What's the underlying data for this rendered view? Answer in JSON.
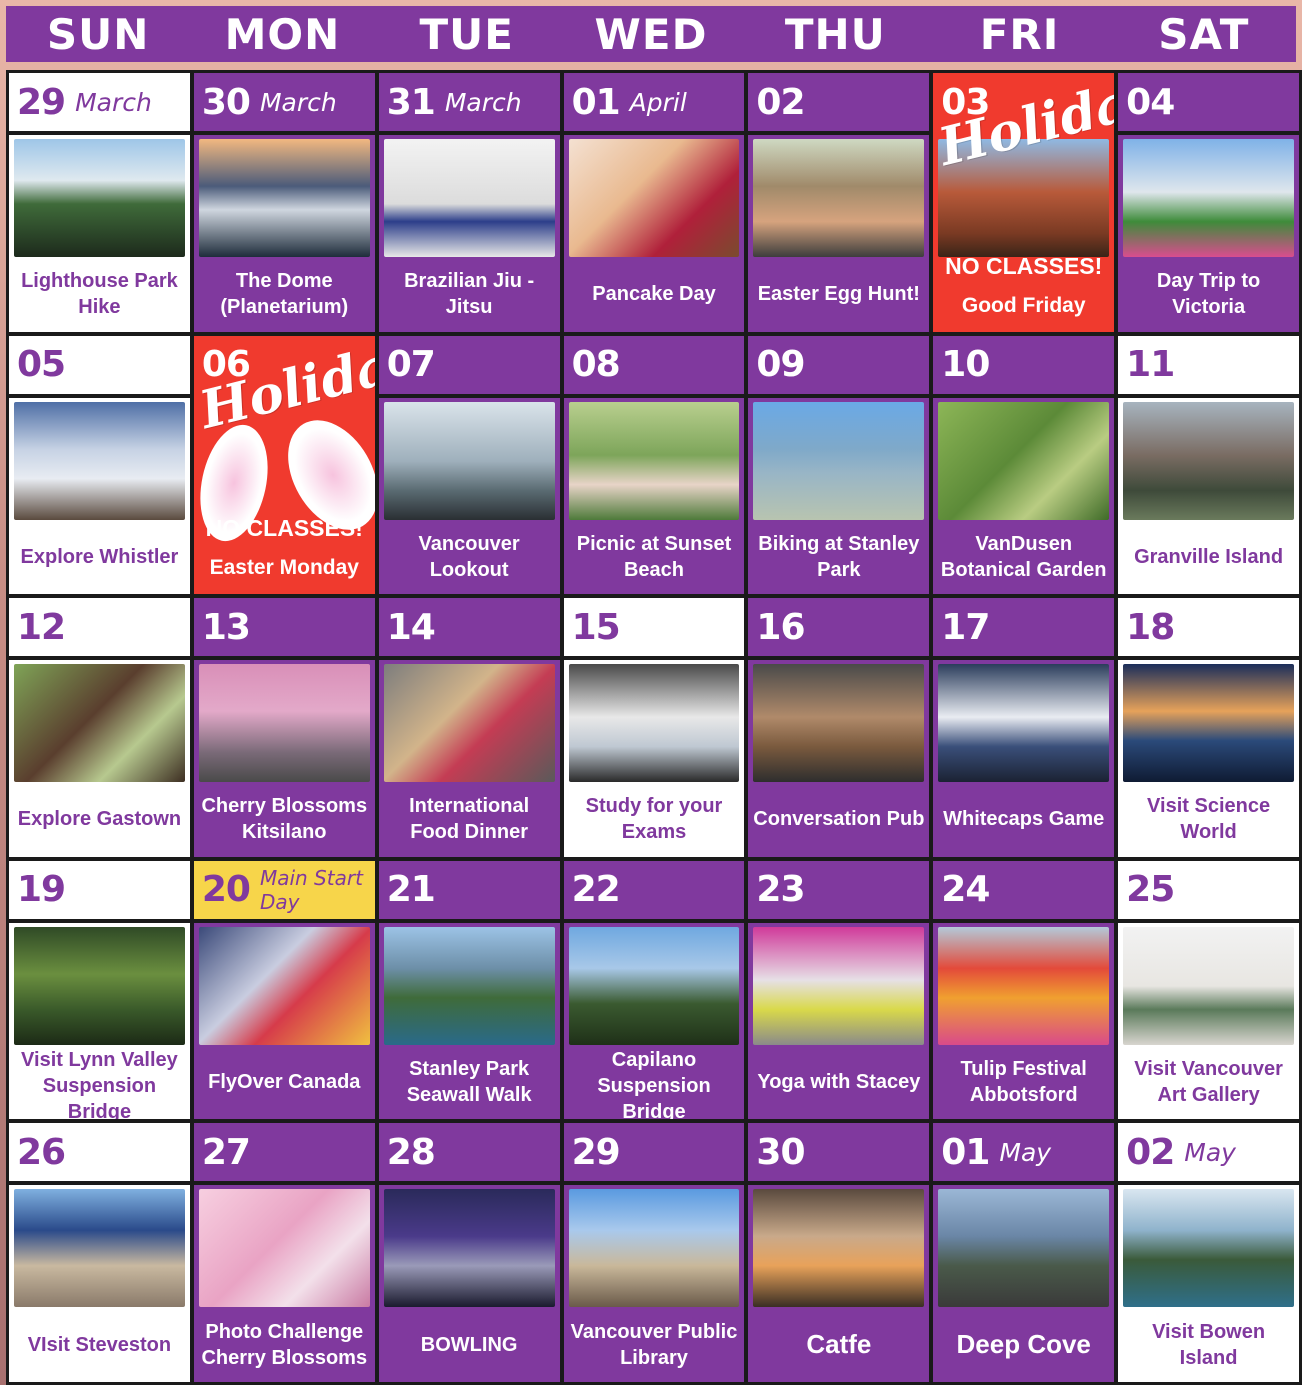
{
  "weekdays": [
    "SUN",
    "MON",
    "TUE",
    "WED",
    "THU",
    "FRI",
    "SAT"
  ],
  "holiday_script": "Holiday",
  "colors": {
    "purple": "#80399e",
    "red": "#f03a2e",
    "yellow": "#f7d54a"
  },
  "days": [
    {
      "num": "29",
      "month": "March",
      "label": "Lighthouse Park Hike",
      "style": "white",
      "photo": "forest-lighthouse"
    },
    {
      "num": "30",
      "month": "March",
      "label": "The Dome (Planetarium)",
      "style": "purple",
      "photo": "dome-planetarium"
    },
    {
      "num": "31",
      "month": "March",
      "label": "Brazilian Jiu - Jitsu",
      "style": "purple",
      "photo": "jiu-jitsu"
    },
    {
      "num": "01",
      "month": "April",
      "label": "Pancake Day",
      "style": "purple",
      "photo": "pancake-day"
    },
    {
      "num": "02",
      "month": "",
      "label": "Easter Egg Hunt!",
      "style": "purple",
      "photo": "easter-group"
    },
    {
      "num": "03",
      "month": "",
      "label": "NO CLASSES!",
      "note": "Good Friday",
      "style": "red",
      "photo": "gastown-clock"
    },
    {
      "num": "04",
      "month": "",
      "label": "Day Trip to Victoria",
      "style": "purple",
      "photo": "victoria-parliament"
    },
    {
      "num": "05",
      "month": "",
      "label": "Explore Whistler",
      "style": "white",
      "photo": "whistler-rings"
    },
    {
      "num": "06",
      "month": "",
      "label": "NO CLASSES!",
      "note": "Easter Monday",
      "style": "red-ears",
      "photo": ""
    },
    {
      "num": "07",
      "month": "",
      "label": "Vancouver Lookout",
      "style": "purple",
      "photo": "lookout-view"
    },
    {
      "num": "08",
      "month": "",
      "label": "Picnic at Sunset Beach",
      "style": "purple",
      "photo": "picnic"
    },
    {
      "num": "09",
      "month": "",
      "label": "Biking at Stanley Park",
      "style": "purple",
      "photo": "biking-seawall"
    },
    {
      "num": "10",
      "month": "",
      "label": "VanDusen Botanical Garden",
      "style": "purple",
      "photo": "hedge-maze"
    },
    {
      "num": "11",
      "month": "",
      "label": "Granville Island",
      "style": "white",
      "photo": "granville-sign"
    },
    {
      "num": "12",
      "month": "",
      "label": "Explore Gastown",
      "style": "white",
      "photo": "gastown-street"
    },
    {
      "num": "13",
      "month": "",
      "label": "Cherry Blossoms Kitsilano",
      "style": "purple",
      "photo": "cherry-street"
    },
    {
      "num": "14",
      "month": "",
      "label": "International Food Dinner",
      "style": "purple",
      "photo": "food-bowls"
    },
    {
      "num": "15",
      "month": "",
      "label": "Study for your Exams",
      "style": "white",
      "photo": "study-student"
    },
    {
      "num": "16",
      "month": "",
      "label": "Conversation Pub",
      "style": "purple",
      "photo": "pub-cheers"
    },
    {
      "num": "17",
      "month": "",
      "label": "Whitecaps Game",
      "style": "purple",
      "photo": "soccer-players"
    },
    {
      "num": "18",
      "month": "",
      "label": "Visit Science World",
      "style": "white",
      "photo": "science-world"
    },
    {
      "num": "19",
      "month": "",
      "label": "Visit Lynn Valley Suspension Bridge",
      "style": "white",
      "photo": "lynn-bridge"
    },
    {
      "num": "20",
      "month": "Main Start Day",
      "label": "FlyOver Canada",
      "style": "yellow",
      "photo": "flyover-welcome"
    },
    {
      "num": "21",
      "month": "",
      "label": "Stanley Park Seawall Walk",
      "style": "purple",
      "photo": "stanley-aerial"
    },
    {
      "num": "22",
      "month": "",
      "label": "Capilano Suspension Bridge",
      "style": "purple",
      "photo": "capilano"
    },
    {
      "num": "23",
      "month": "",
      "label": "Yoga with Stacey",
      "style": "purple",
      "photo": "yoga-class"
    },
    {
      "num": "24",
      "month": "",
      "label": "Tulip Festival Abbotsford",
      "style": "purple",
      "photo": "tulip-field"
    },
    {
      "num": "25",
      "month": "",
      "label": "Visit Vancouver Art Gallery",
      "style": "white",
      "photo": "art-gallery"
    },
    {
      "num": "26",
      "month": "",
      "label": "VIsit Steveston",
      "style": "white",
      "photo": "fishermans-wharf"
    },
    {
      "num": "27",
      "month": "",
      "label": "Photo Challenge Cherry Blossoms",
      "style": "purple",
      "photo": "cherry-closeup"
    },
    {
      "num": "28",
      "month": "",
      "label": "BOWLING",
      "style": "purple",
      "photo": "bowling-group"
    },
    {
      "num": "29",
      "month": "",
      "label": "Vancouver Public Library",
      "style": "purple",
      "photo": "library"
    },
    {
      "num": "30",
      "month": "",
      "label": "Catfe",
      "style": "purple-big",
      "photo": "cat-cafe"
    },
    {
      "num": "01",
      "month": "May",
      "label": "Deep Cove",
      "style": "purple-big",
      "photo": "deep-cove"
    },
    {
      "num": "02",
      "month": "May",
      "label": "Visit Bowen Island",
      "style": "white",
      "photo": "bowen-aerial"
    }
  ]
}
